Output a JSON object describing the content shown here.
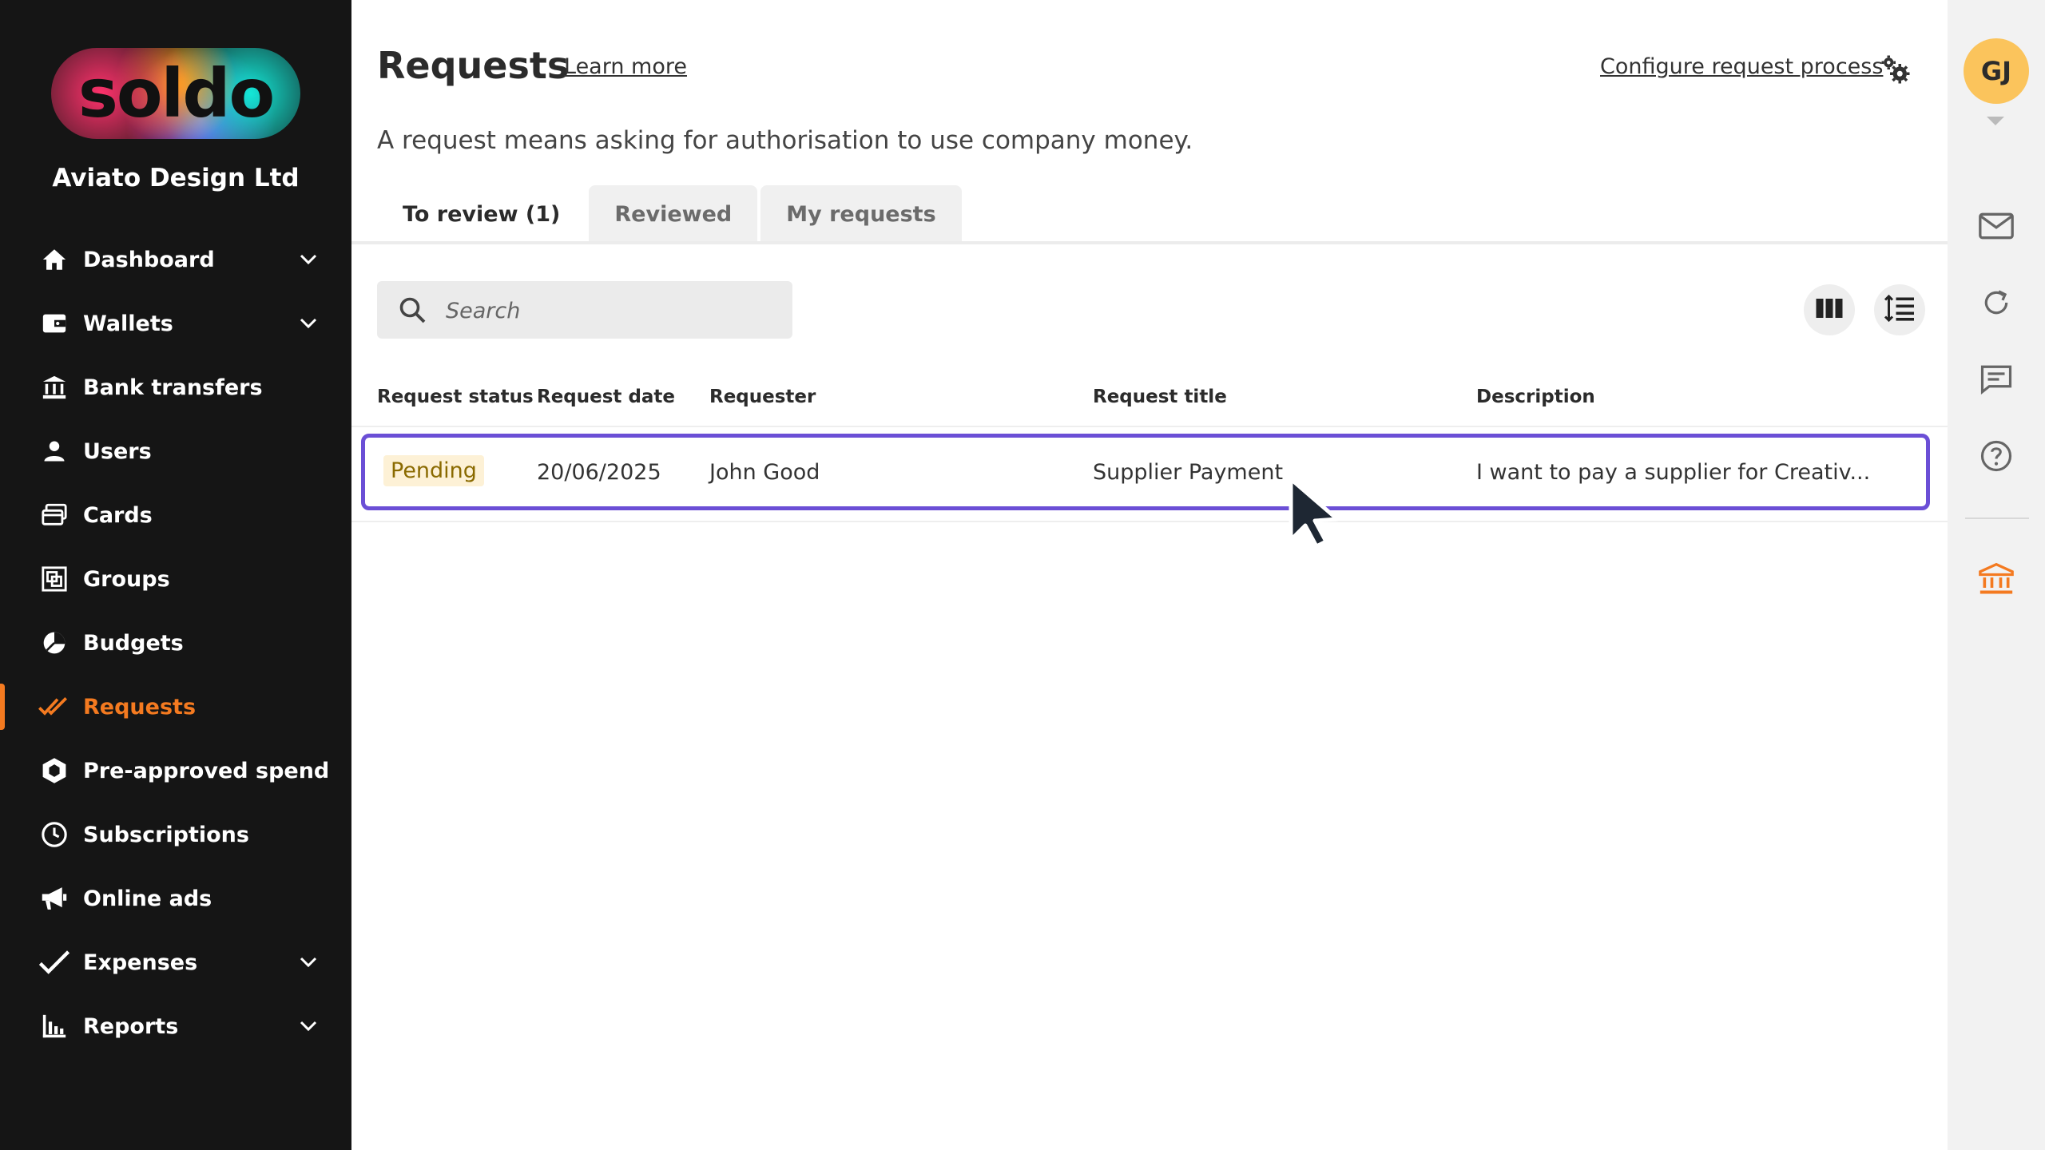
{
  "brand": {
    "logo_text": "soldo",
    "company": "Aviato Design Ltd"
  },
  "nav": {
    "items": [
      {
        "label": "Dashboard",
        "icon": "home-icon",
        "has_chevron": true
      },
      {
        "label": "Wallets",
        "icon": "wallet-icon",
        "has_chevron": true
      },
      {
        "label": "Bank transfers",
        "icon": "bank-transfer-icon",
        "has_chevron": false
      },
      {
        "label": "Users",
        "icon": "user-icon",
        "has_chevron": false
      },
      {
        "label": "Cards",
        "icon": "cards-icon",
        "has_chevron": false
      },
      {
        "label": "Groups",
        "icon": "groups-icon",
        "has_chevron": false
      },
      {
        "label": "Budgets",
        "icon": "pie-chart-icon",
        "has_chevron": false
      },
      {
        "label": "Requests",
        "icon": "double-check-icon",
        "has_chevron": false,
        "active": true
      },
      {
        "label": "Pre-approved spend",
        "icon": "hexagon-icon",
        "has_chevron": false
      },
      {
        "label": "Subscriptions",
        "icon": "clock-icon",
        "has_chevron": false
      },
      {
        "label": "Online ads",
        "icon": "megaphone-icon",
        "has_chevron": false
      },
      {
        "label": "Expenses",
        "icon": "check-pen-icon",
        "has_chevron": true
      },
      {
        "label": "Reports",
        "icon": "bar-chart-icon",
        "has_chevron": true
      }
    ]
  },
  "header": {
    "title": "Requests",
    "learn_more": "Learn more",
    "configure": "Configure request process",
    "subtitle": "A request means asking for authorisation to use company money."
  },
  "tabs": [
    {
      "label": "To review (1)",
      "active": true
    },
    {
      "label": "Reviewed",
      "active": false
    },
    {
      "label": "My requests",
      "active": false
    }
  ],
  "search": {
    "placeholder": "Search"
  },
  "table": {
    "columns": [
      "Request status",
      "Request date",
      "Requester",
      "Request title",
      "Description"
    ],
    "rows": [
      {
        "status": "Pending",
        "date": "20/06/2025",
        "requester": "John Good",
        "title": "Supplier Payment",
        "description": "I want to pay a supplier for Creativ..."
      }
    ]
  },
  "user": {
    "initials": "GJ"
  },
  "colors": {
    "sidebar_bg": "#151515",
    "accent": "#f47a20",
    "row_highlight": "#6b4fd6",
    "pending_badge_bg": "#fdf1d6",
    "avatar_bg": "#fbc45c"
  }
}
